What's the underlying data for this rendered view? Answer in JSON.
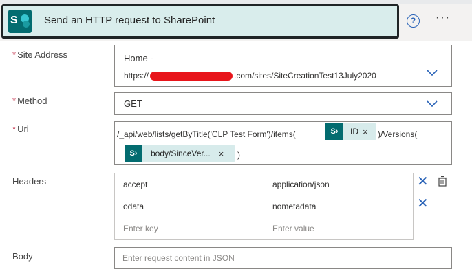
{
  "action": {
    "title": "Send an HTTP request to SharePoint",
    "logo_letter": "S",
    "help_glyph": "?",
    "more_glyph": "···",
    "icons": [
      "sharepoint-logo-icon",
      "help-icon",
      "more-icon"
    ]
  },
  "fields": {
    "site_address": {
      "label": "Site Address",
      "required_mark": "*",
      "line1": "Home -",
      "line2_prefix": "https://",
      "line2_suffix": ".com/sites/SiteCreationTest13July2020"
    },
    "method": {
      "label": "Method",
      "required_mark": "*",
      "value": "GET"
    },
    "uri": {
      "label": "Uri",
      "required_mark": "*",
      "text1": "/_api/web/lists/getByTitle('CLP Test Form')/items(",
      "token1": "ID",
      "text2": ")/Versions(",
      "token2": "body/SinceVer...",
      "text3": ")",
      "token_close": "×"
    },
    "headers": {
      "label": "Headers",
      "rows": [
        {
          "key": "accept",
          "value": "application/json"
        },
        {
          "key": "odata",
          "value": "nometadata"
        }
      ],
      "key_placeholder": "Enter key",
      "value_placeholder": "Enter value",
      "remove_glyph": "✕"
    },
    "body": {
      "label": "Body",
      "placeholder": "Enter request content in JSON"
    }
  },
  "colors": {
    "brand": "#036c70",
    "accent": "#2b64b8",
    "required": "#c4314b",
    "header_card": "#d9edec",
    "token_bg": "#d7ebeb"
  }
}
